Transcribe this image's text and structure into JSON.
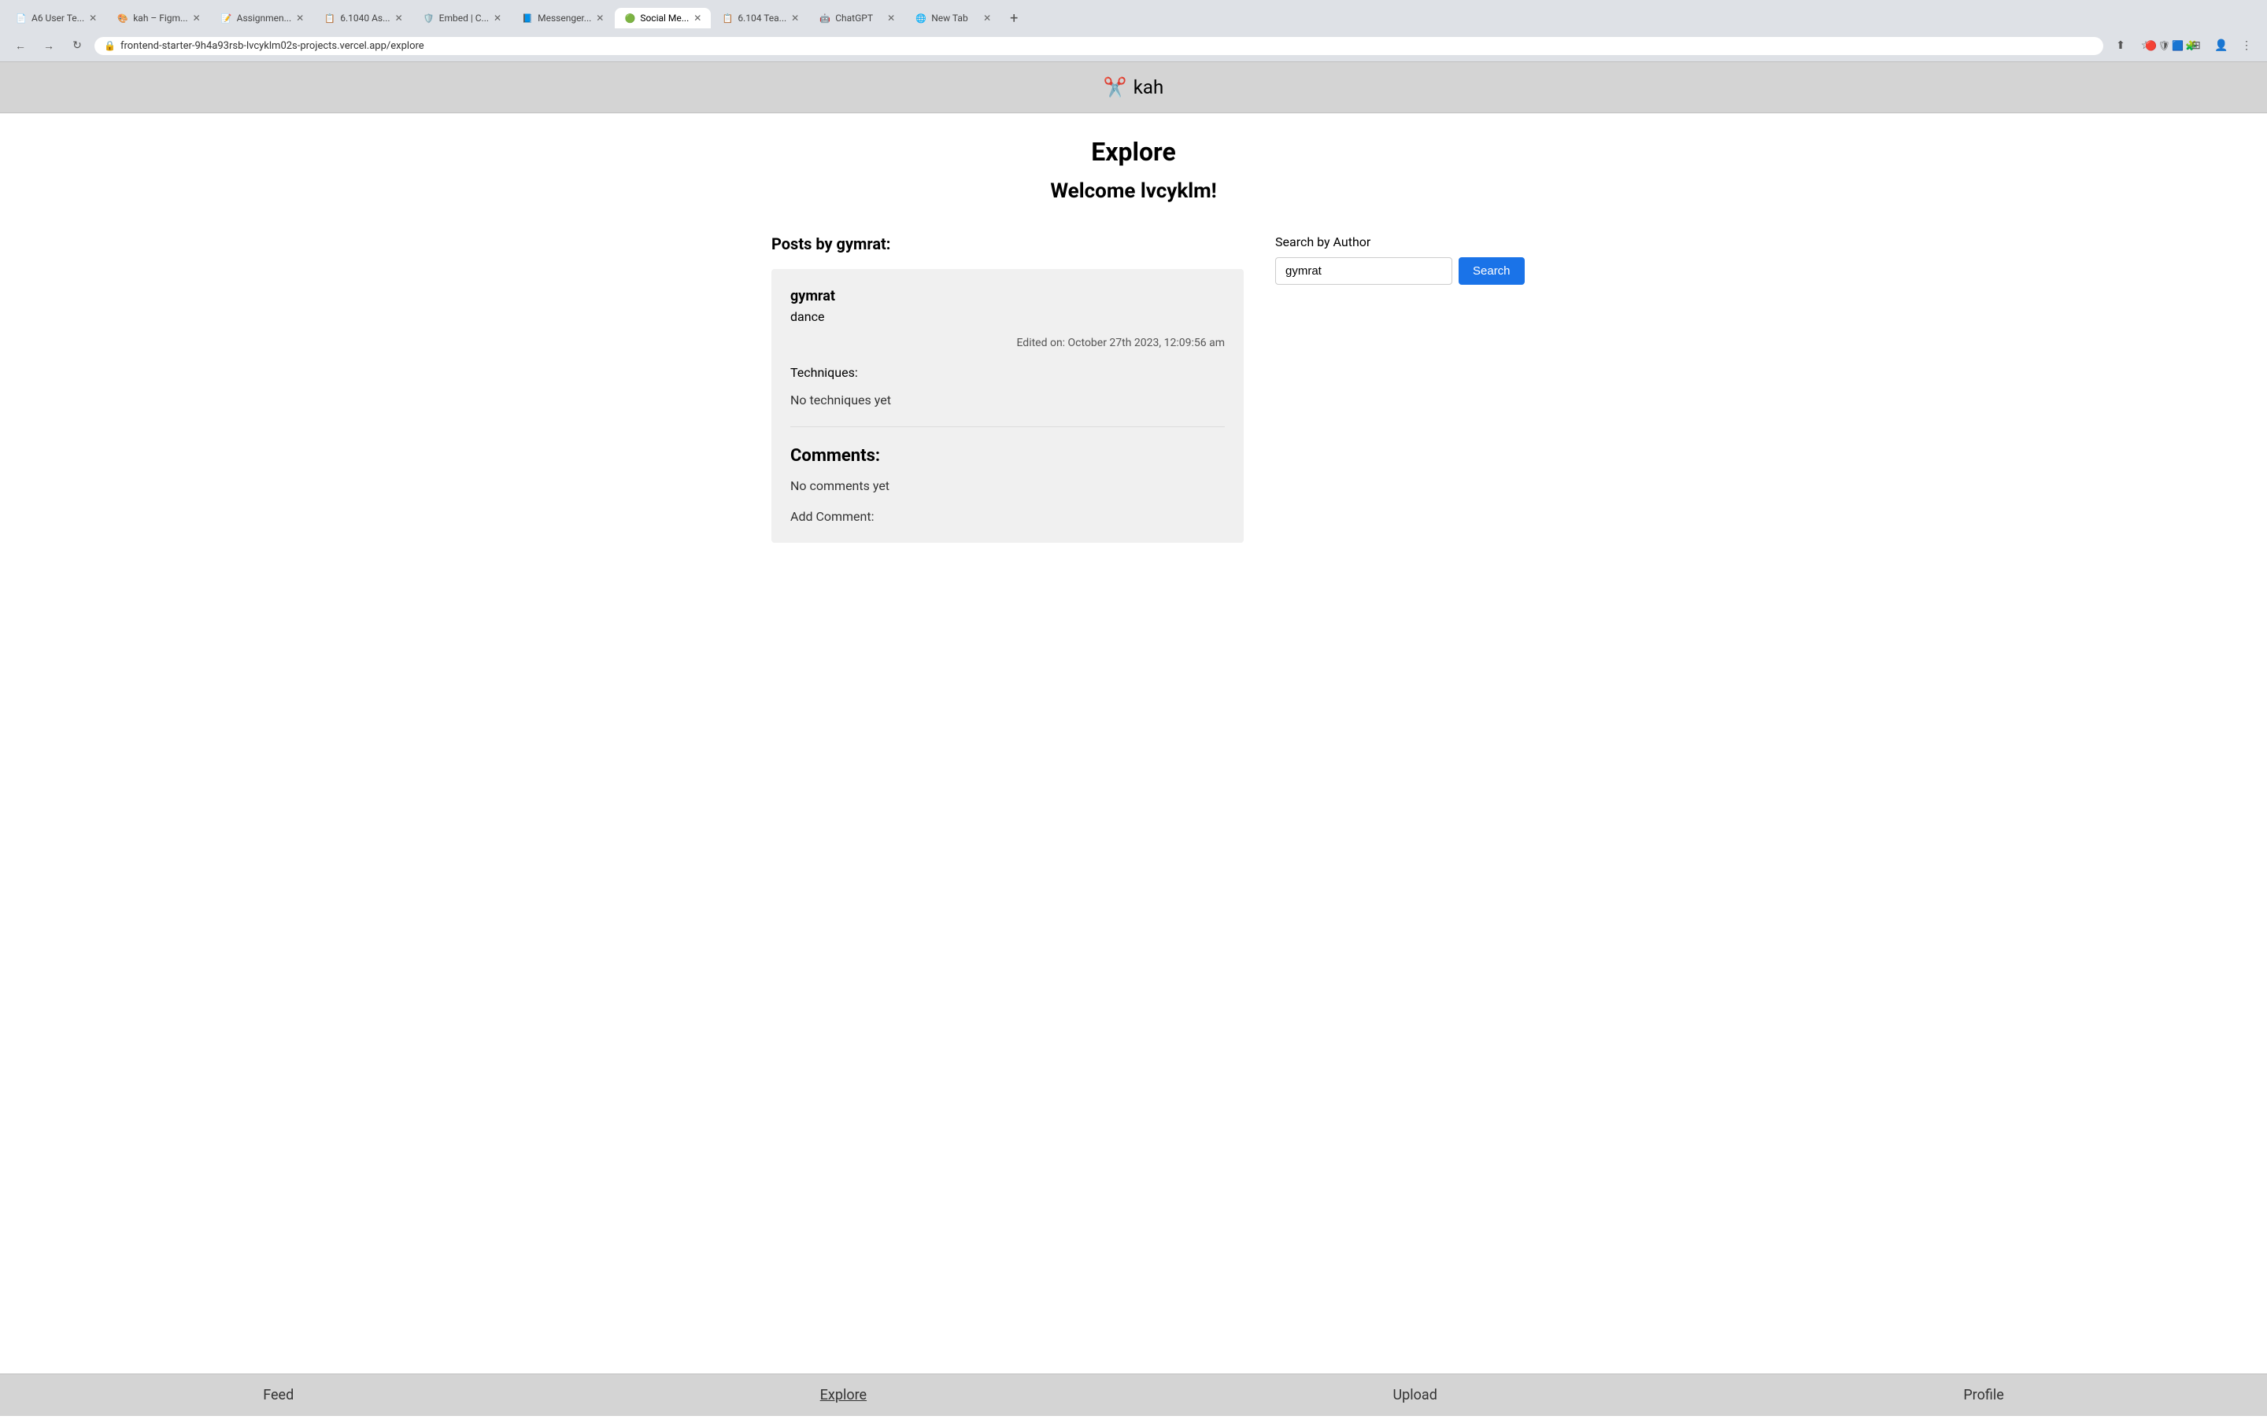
{
  "browser": {
    "tabs": [
      {
        "id": "tab-1",
        "favicon": "📄",
        "label": "A6 User Te...",
        "active": false
      },
      {
        "id": "tab-2",
        "favicon": "🎨",
        "label": "kah – Figm...",
        "active": false
      },
      {
        "id": "tab-3",
        "favicon": "📝",
        "label": "Assignmen...",
        "active": false
      },
      {
        "id": "tab-4",
        "favicon": "📋",
        "label": "6.1040 As...",
        "active": false
      },
      {
        "id": "tab-5",
        "favicon": "🛡️",
        "label": "Embed | C...",
        "active": false
      },
      {
        "id": "tab-6",
        "favicon": "📘",
        "label": "Messenger...",
        "active": false
      },
      {
        "id": "tab-7",
        "favicon": "🟢",
        "label": "Social Me...",
        "active": true
      },
      {
        "id": "tab-8",
        "favicon": "📋",
        "label": "6.104 Tea...",
        "active": false
      },
      {
        "id": "tab-9",
        "favicon": "🤖",
        "label": "ChatGPT",
        "active": false
      },
      {
        "id": "tab-10",
        "favicon": "🌐",
        "label": "New Tab",
        "active": false
      }
    ],
    "url": "frontend-starter-9h4a93rsb-lvcyklm02s-projects.vercel.app/explore"
  },
  "app": {
    "logo_icon": "✂️",
    "logo_text": "kah"
  },
  "header": {
    "page_title": "Explore",
    "welcome_text": "Welcome lvcyklm!"
  },
  "posts_section": {
    "heading": "Posts by gymrat:"
  },
  "search": {
    "label": "Search by Author",
    "input_value": "gymrat",
    "button_label": "Search"
  },
  "post": {
    "author": "gymrat",
    "title": "dance",
    "edited_text": "Edited on: October 27th 2023, 12:09:56 am",
    "techniques_heading": "Techniques:",
    "no_techniques_text": "No techniques yet",
    "comments_heading": "Comments:",
    "no_comments_text": "No comments yet",
    "add_comment_label": "Add Comment:"
  },
  "bottom_nav": {
    "items": [
      {
        "id": "feed",
        "label": "Feed",
        "active": false
      },
      {
        "id": "explore",
        "label": "Explore",
        "active": true
      },
      {
        "id": "upload",
        "label": "Upload",
        "active": false
      },
      {
        "id": "profile",
        "label": "Profile",
        "active": false
      }
    ]
  }
}
